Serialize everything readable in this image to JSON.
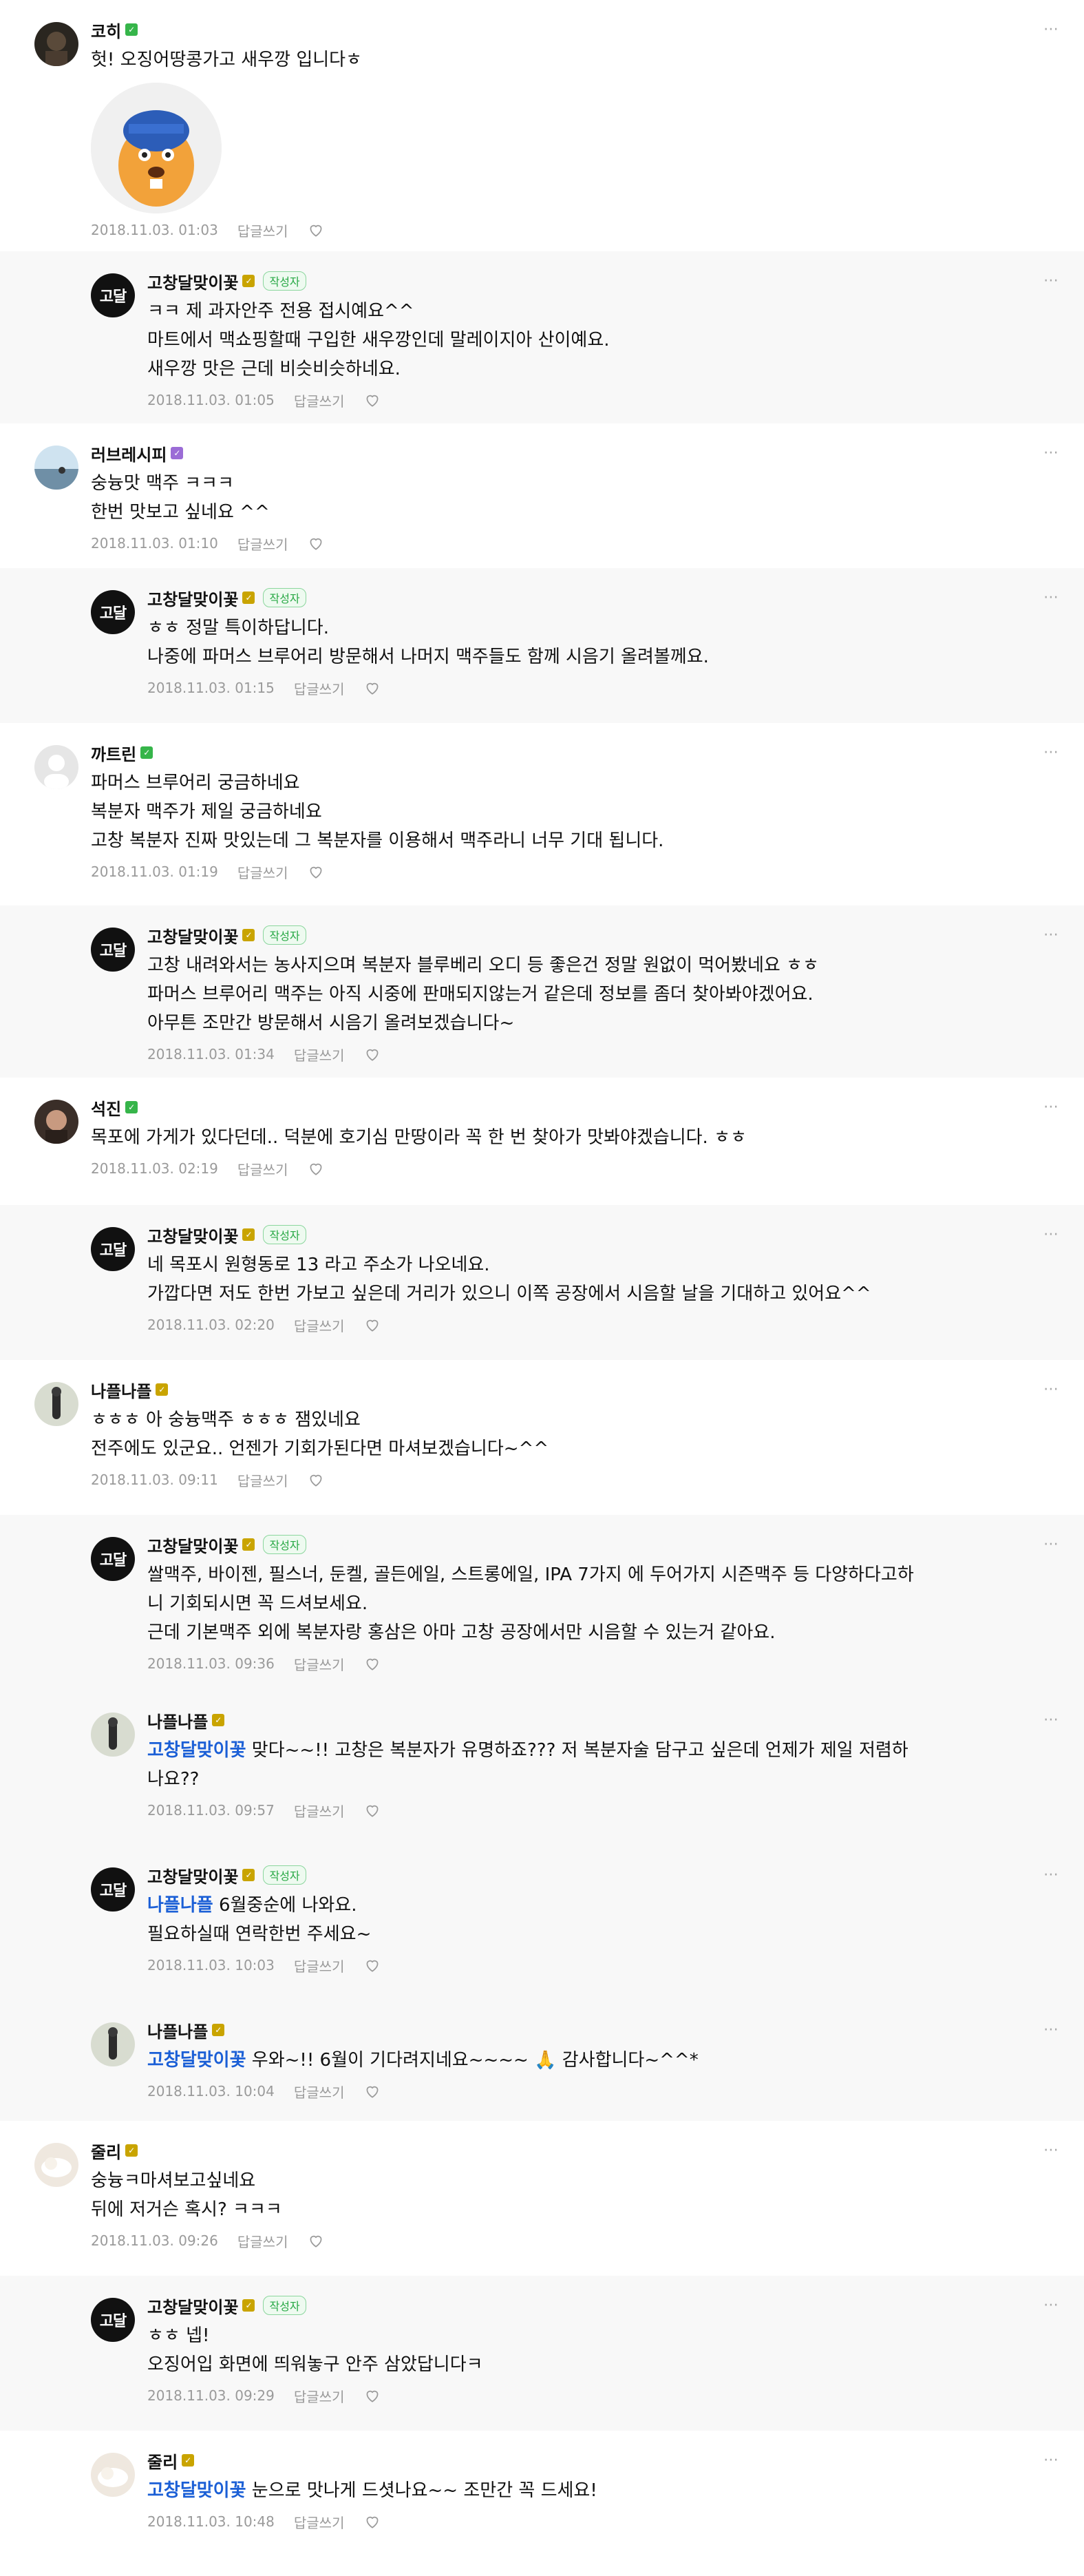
{
  "comments": [
    {
      "kind": "top",
      "name": "코히",
      "grade": "green",
      "text": "헛! 오징어땅콩가고 새우깡 입니다ㅎ",
      "date": "2018.11.03. 01:03",
      "reply": "답글쓰기",
      "avatar": "dark-photo",
      "attachment": true
    },
    {
      "kind": "reply",
      "name": "고창달맞이꽃",
      "grade": "gold",
      "author": "작성자",
      "text": "ㅋㅋ 제 과자안주 전용 접시예요^^\n마트에서 맥쇼핑할때 구입한 새우깡인데 말레이지아 산이예요.\n새우깡 맛은 근데 비슷비슷하네요.",
      "date": "2018.11.03. 01:05",
      "reply": "답글쓰기",
      "avatar": "logo"
    },
    {
      "kind": "top",
      "name": "러브레시피",
      "grade": "purple",
      "text": "숭늉맛 맥주 ㅋㅋㅋ\n한번 맛보고 싶네요 ^^",
      "date": "2018.11.03. 01:10",
      "reply": "답글쓰기",
      "avatar": "sea"
    },
    {
      "kind": "reply",
      "name": "고창달맞이꽃",
      "grade": "gold",
      "author": "작성자",
      "text": "ㅎㅎ 정말 특이하답니다.\n나중에 파머스 브루어리 방문해서 나머지 맥주들도 함께 시음기 올려볼께요.",
      "date": "2018.11.03. 01:15",
      "reply": "답글쓰기",
      "avatar": "logo"
    },
    {
      "kind": "top",
      "name": "까트린",
      "grade": "green",
      "text": "파머스 브루어리 궁금하네요\n복분자 맥주가 제일 궁금하네요\n고창 복분자 진짜 맛있는데 그 복분자를 이용해서 맥주라니 너무 기대 됩니다.",
      "date": "2018.11.03. 01:19",
      "reply": "답글쓰기",
      "avatar": "default"
    },
    {
      "kind": "reply",
      "name": "고창달맞이꽃",
      "grade": "gold",
      "author": "작성자",
      "text": "고창 내려와서는 농사지으며 복분자 블루베리 오디 등 좋은건 정말 원없이 먹어봤네요 ㅎㅎ\n파머스 브루어리 맥주는 아직 시중에 판매되지않는거 같은데 정보를 좀더 찾아봐야겠어요.\n아무튼 조만간 방문해서 시음기 올려보겠습니다~",
      "date": "2018.11.03. 01:34",
      "reply": "답글쓰기",
      "avatar": "logo"
    },
    {
      "kind": "top",
      "name": "석진",
      "grade": "green",
      "text": "목포에 가게가 있다던데.. 덕분에 호기심 만땅이라 꼭 한 번 찾아가 맛봐야겠습니다. ㅎㅎ",
      "date": "2018.11.03. 02:19",
      "reply": "답글쓰기",
      "avatar": "face"
    },
    {
      "kind": "reply",
      "name": "고창달맞이꽃",
      "grade": "gold",
      "author": "작성자",
      "text": "네 목포시 원형동로 13 라고 주소가 나오네요.\n가깝다면 저도 한번 가보고 싶은데 거리가 있으니 이쪽 공장에서 시음할 날을 기대하고 있어요^^",
      "date": "2018.11.03. 02:20",
      "reply": "답글쓰기",
      "avatar": "logo"
    },
    {
      "kind": "top",
      "name": "나플나플",
      "grade": "gold",
      "text": "ㅎㅎㅎ 아 숭늉맥주 ㅎㅎㅎ 잼있네요\n전주에도 있군요.. 언젠가 기회가된다면 마셔보겠습니다~^^",
      "date": "2018.11.03. 09:11",
      "reply": "답글쓰기",
      "avatar": "figure"
    },
    {
      "kind": "reply",
      "name": "고창달맞이꽃",
      "grade": "gold",
      "author": "작성자",
      "text": "쌀맥주, 바이젠, 필스너, 둔켈, 골든에일, 스트롱에일, IPA 7가지 에 두어가지 시즌맥주 등 다양하다고하\n니 기회되시면 꼭 드셔보세요.\n근데 기본맥주 외에 복분자랑 홍삼은 아마 고창 공장에서만 시음할 수 있는거 같아요.",
      "date": "2018.11.03. 09:36",
      "reply": "답글쓰기",
      "avatar": "logo"
    },
    {
      "kind": "reply",
      "name": "나플나플",
      "grade": "gold",
      "mention": "고창달맞이꽃",
      "text": " 맞다~~!! 고창은 복분자가 유명하죠??? 저 복분자술 담구고 싶은데 언제가 제일 저렴하\n나요??",
      "date": "2018.11.03. 09:57",
      "reply": "답글쓰기",
      "avatar": "figure"
    },
    {
      "kind": "reply",
      "name": "고창달맞이꽃",
      "grade": "gold",
      "author": "작성자",
      "mention": "나플나플",
      "text": " 6월중순에 나와요.\n필요하실때 연락한번 주세요~",
      "date": "2018.11.03. 10:03",
      "reply": "답글쓰기",
      "avatar": "logo"
    },
    {
      "kind": "reply",
      "name": "나플나플",
      "grade": "gold",
      "mention": "고창달맞이꽃",
      "text": " 우와~!! 6월이 기다려지네요~~~~ 🙏 감사합니다~^^*",
      "date": "2018.11.03. 10:04",
      "reply": "답글쓰기",
      "avatar": "figure"
    },
    {
      "kind": "top",
      "name": "줄리",
      "grade": "gold",
      "text": "숭늉ㅋ마셔보고싶네요\n뒤에 저거슨 혹시? ㅋㅋㅋ",
      "date": "2018.11.03. 09:26",
      "reply": "답글쓰기",
      "avatar": "cloud"
    },
    {
      "kind": "reply",
      "name": "고창달맞이꽃",
      "grade": "gold",
      "author": "작성자",
      "text": "ㅎㅎ 넵!\n오징어입 화면에 띄워놓구 안주 삼았답니다ㅋ",
      "date": "2018.11.03. 09:29",
      "reply": "답글쓰기",
      "avatar": "logo"
    },
    {
      "kind": "reply",
      "name": "줄리",
      "grade": "gold",
      "mention": "고창달맞이꽃",
      "text": " 눈으로 맛나게 드셧나요~~ 조만간 꼭 드세요!",
      "date": "2018.11.03. 10:48",
      "reply": "답글쓰기",
      "avatar": "cloud",
      "nobg": true
    }
  ],
  "logo_text": "고달",
  "more_icon": "⋯",
  "colors": {
    "gold": "#c9a400",
    "green": "#36b54a",
    "purple": "#9b6cd6",
    "mention": "#1b5fd6"
  }
}
